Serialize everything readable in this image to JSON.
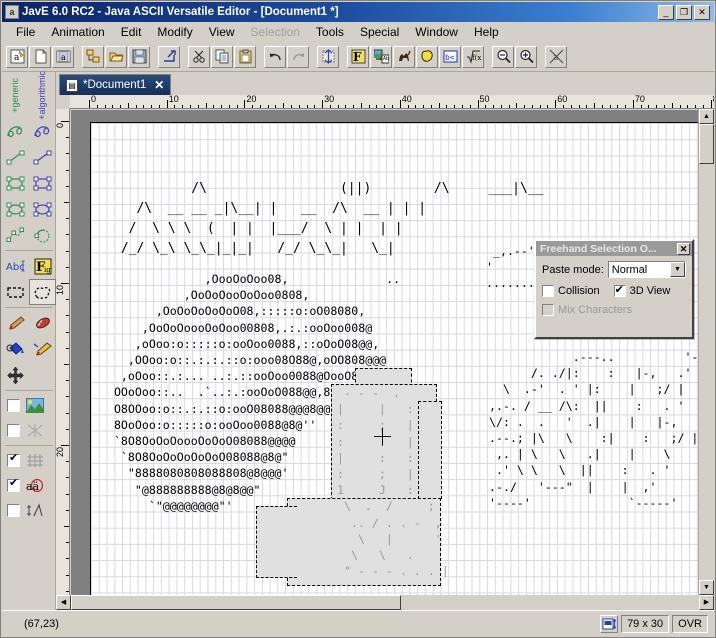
{
  "window": {
    "title": "JavE 6.0 RC2 - Java ASCII Versatile Editor - [Document1 *]",
    "icon": "app-icon",
    "minimize": "_",
    "maximize": "❐",
    "close": "✕"
  },
  "menu": {
    "items": [
      {
        "label": "File",
        "disabled": false
      },
      {
        "label": "Animation",
        "disabled": false
      },
      {
        "label": "Edit",
        "disabled": false
      },
      {
        "label": "Modify",
        "disabled": false
      },
      {
        "label": "View",
        "disabled": false
      },
      {
        "label": "Selection",
        "disabled": true
      },
      {
        "label": "Tools",
        "disabled": false
      },
      {
        "label": "Special",
        "disabled": false
      },
      {
        "label": "Window",
        "disabled": false
      },
      {
        "label": "Help",
        "disabled": false
      }
    ]
  },
  "toolbar": {
    "buttons": [
      {
        "name": "new-ascii-art-icon",
        "sep_after": false
      },
      {
        "name": "new-document-icon",
        "sep_after": false
      },
      {
        "name": "animation-film-icon",
        "sep_after": true
      },
      {
        "name": "project-tree-icon",
        "sep_after": false
      },
      {
        "name": "open-folder-icon",
        "sep_after": false
      },
      {
        "name": "save-icon",
        "sep_after": true
      },
      {
        "name": "export-icon",
        "sep_after": true
      },
      {
        "name": "cut-scissors-icon",
        "sep_after": false
      },
      {
        "name": "copy-icon",
        "sep_after": false
      },
      {
        "name": "paste-icon",
        "sep_after": true
      },
      {
        "name": "undo-icon",
        "sep_after": false
      },
      {
        "name": "redo-icon",
        "sep_after": true
      },
      {
        "name": "resize-canvas-icon",
        "sep_after": true
      },
      {
        "name": "figlet-text-icon",
        "sep_after": false
      },
      {
        "name": "image-to-ascii-icon",
        "sep_after": false
      },
      {
        "name": "camel-icon",
        "sep_after": false
      },
      {
        "name": "shape-icon",
        "sep_after": false
      },
      {
        "name": "bcd-icon",
        "sep_after": false
      },
      {
        "name": "formula-icon",
        "sep_after": true
      },
      {
        "name": "zoom-out-icon",
        "sep_after": false
      },
      {
        "name": "zoom-in-icon",
        "sep_after": true
      },
      {
        "name": "clear-icon",
        "sep_after": false
      }
    ]
  },
  "toolpanel": {
    "column_labels": [
      {
        "label": "+generic",
        "color": "#2e8b57"
      },
      {
        "label": "+algorithmic",
        "color": "#4040c0"
      }
    ],
    "tools": [
      {
        "name": "freehand-generic-icon"
      },
      {
        "name": "freehand-algorithmic-icon"
      },
      {
        "name": "line-generic-icon"
      },
      {
        "name": "line-algorithmic-icon"
      },
      {
        "name": "rectangle-generic-icon"
      },
      {
        "name": "rectangle-algorithmic-icon"
      },
      {
        "name": "ellipse-generic-icon"
      },
      {
        "name": "ellipse-algorithmic-icon"
      },
      {
        "name": "polyline-icon"
      },
      {
        "name": "arc-icon"
      }
    ],
    "text_tools": [
      {
        "name": "text-abc-icon"
      },
      {
        "name": "figlet-fig-icon"
      }
    ],
    "selection_tools": [
      {
        "name": "rect-selection-icon",
        "selected": false
      },
      {
        "name": "freehand-selection-icon",
        "selected": true
      }
    ],
    "paint_tools": [
      {
        "name": "brush-icon"
      },
      {
        "name": "eraser-icon"
      },
      {
        "name": "fill-bucket-icon"
      },
      {
        "name": "airbrush-icon"
      },
      {
        "name": "move-icon"
      }
    ],
    "options": [
      {
        "name": "background-image-option",
        "label": "",
        "checked": false,
        "icon": "landscape-image-icon"
      },
      {
        "name": "hide-lines-option",
        "label": "",
        "checked": false,
        "icon": "crossed-lines-icon"
      },
      {
        "name": "show-grid-option",
        "label": "",
        "checked": true,
        "icon": "grid-icon"
      },
      {
        "name": "highlight-chars-option",
        "label": "",
        "checked": true,
        "icon": "char-highlight-icon"
      },
      {
        "name": "angle-snap-option",
        "label": "",
        "checked": false,
        "icon": "angle-icon"
      }
    ]
  },
  "tab": {
    "label": "*Document1",
    "close": "✕",
    "icon": "document-icon"
  },
  "rulers": {
    "horizontal_ticks": [
      0,
      10,
      20,
      30,
      40,
      50,
      60,
      70
    ],
    "vertical_ticks": [
      0,
      10,
      20
    ]
  },
  "canvas": {
    "ascii_title": [
      "          /\\                 (||)        /\\     ___|\\__ ",
      "   /\\  __ __ _|\\__| |   __  /\\  __ | | | ",
      "  /  \\ \\ \\  (  | |  |___/  \\ | |  | |  ",
      " /_/ \\_\\ \\_\\_|_|_|   /_/ \\_\\_|   \\_| "
    ],
    "ascii_body": [
      "                ,OooOoOoo08,              ..",
      "             ,OoOoOooOoOoo0808,",
      "         ,OoOoOoOoOoO08,:::::o:oO08080,",
      "       ,OoOoOoooOoOoo00808,.:.:ooOoo008@",
      "      ,oOoo:o:::::o:ooOoo0088,::oOoO08@@,",
      "     ,OOoo:o::.:.:.::o:ooo08O88@,oOO808@@@",
      "    ,oOoo::.:... ..:.::ooOoo0088@OooO888@'",
      "   OOoOoo::..  .`..:.:ooOoO088@@,8088@@@",
      "   O8OOoo:o::.:.::o:ooO08088@@@8@@\"",
      "   8OoOoo:o:::::o:ooOoo0088@8@''",
      "   `8O8OoOoOoooOoOoO08088@@@@",
      "    `8O8OoOoOoOoOoO08088@8@\"",
      "     \"8888080808088808@8@@@'",
      "      \"@888888888@8@8@@\"",
      "        `\"@@@@@@@@\"'"
    ],
    "selection_label_1": "1",
    "selection_label_2": "J",
    "cursor_position": "(67,23)"
  },
  "dialog": {
    "title": "Freehand Selection O...",
    "close": "✕",
    "paste_mode_label": "Paste mode:",
    "paste_mode_value": "Normal",
    "paste_mode_options": [
      "Normal"
    ],
    "collision_label": "Collision",
    "collision_checked": false,
    "view3d_label": "3D View",
    "view3d_checked": true,
    "mix_chars_label": "Mix Characters",
    "mix_chars_checked": false,
    "mix_chars_disabled": true
  },
  "statusbar": {
    "coordinates": "(67,23)",
    "size_icon": "canvas-size-icon",
    "size": "79 x 30",
    "mode": "OVR"
  }
}
